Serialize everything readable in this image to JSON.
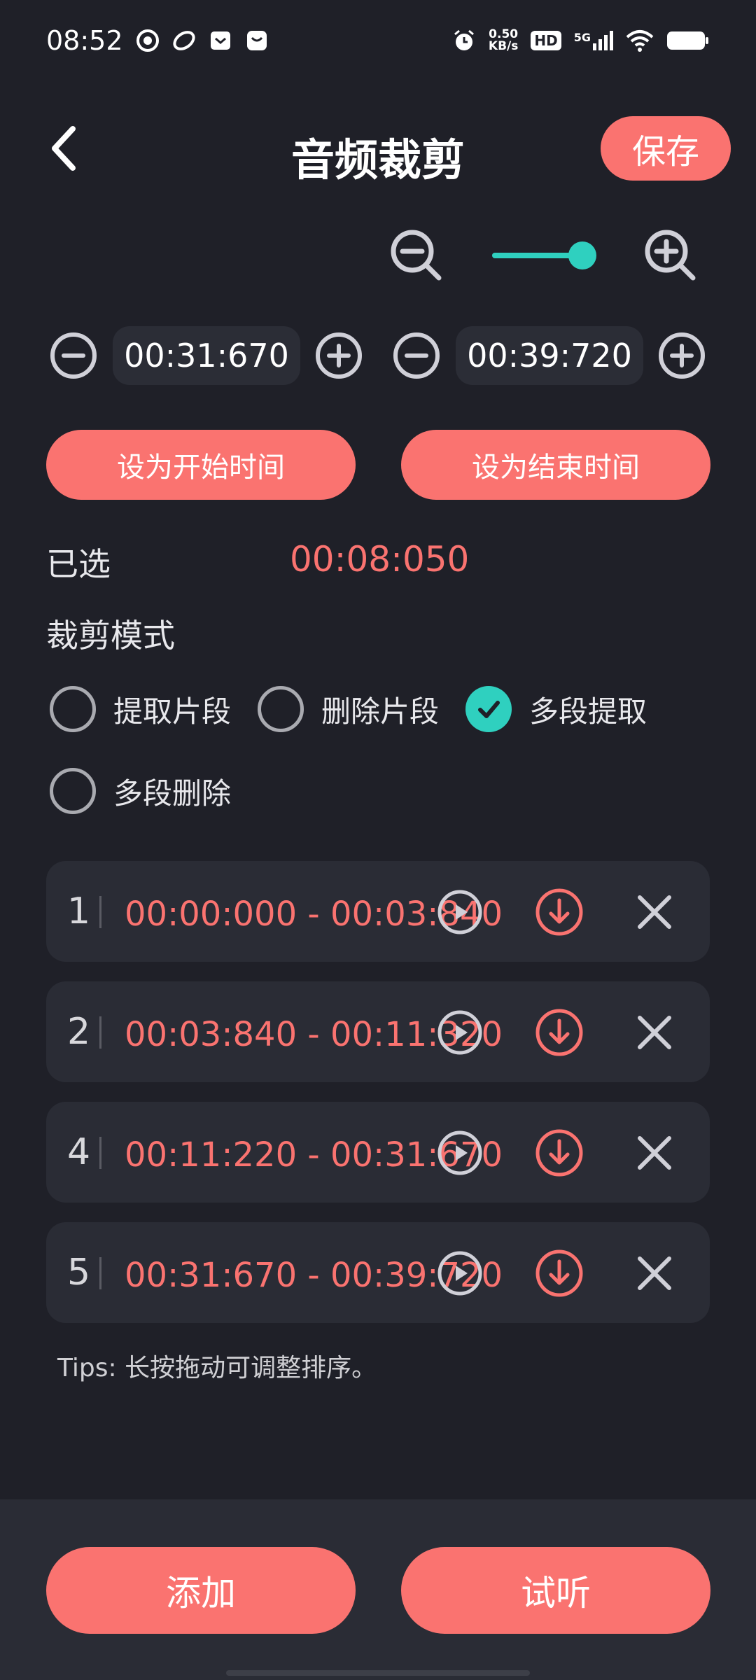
{
  "status_bar": {
    "time": "08:52",
    "net_speed_value": "0.50",
    "net_speed_unit": "KB/s",
    "hd": "HD",
    "signal": "5G",
    "icons": [
      "record-icon",
      "app-icon",
      "store-icon",
      "message-icon",
      "alarm-icon",
      "hd-icon",
      "signal-5g-icon",
      "wifi-icon",
      "battery-icon"
    ]
  },
  "header": {
    "title": "音频裁剪",
    "save_label": "保存"
  },
  "zoom": {
    "level": 1.0,
    "accent": "#2fd0bf"
  },
  "times": {
    "start": "00:31:670",
    "end": "00:39:720"
  },
  "actions": {
    "set_start": "设为开始时间",
    "set_end": "设为结束时间"
  },
  "selected": {
    "label": "已选",
    "value": "00:08:050"
  },
  "mode": {
    "label": "裁剪模式",
    "options": [
      {
        "label": "提取片段",
        "checked": false
      },
      {
        "label": "删除片段",
        "checked": false
      },
      {
        "label": "多段提取",
        "checked": true
      },
      {
        "label": "多段删除",
        "checked": false
      }
    ]
  },
  "segments": [
    {
      "index": "1",
      "range": "00:00:000  -  00:03:840"
    },
    {
      "index": "2",
      "range": "00:03:840  -  00:11:320"
    },
    {
      "index": "4",
      "range": "00:11:220  -  00:31:670"
    },
    {
      "index": "5",
      "range": "00:31:670  -  00:39:720"
    }
  ],
  "tips": "Tips:  长按拖动可调整排序。",
  "bottom": {
    "add": "添加",
    "listen": "试听"
  },
  "colors": {
    "accent_red": "#fa7370",
    "accent_teal": "#2fd0bf",
    "background": "#1f2028",
    "card": "#2a2c35"
  }
}
